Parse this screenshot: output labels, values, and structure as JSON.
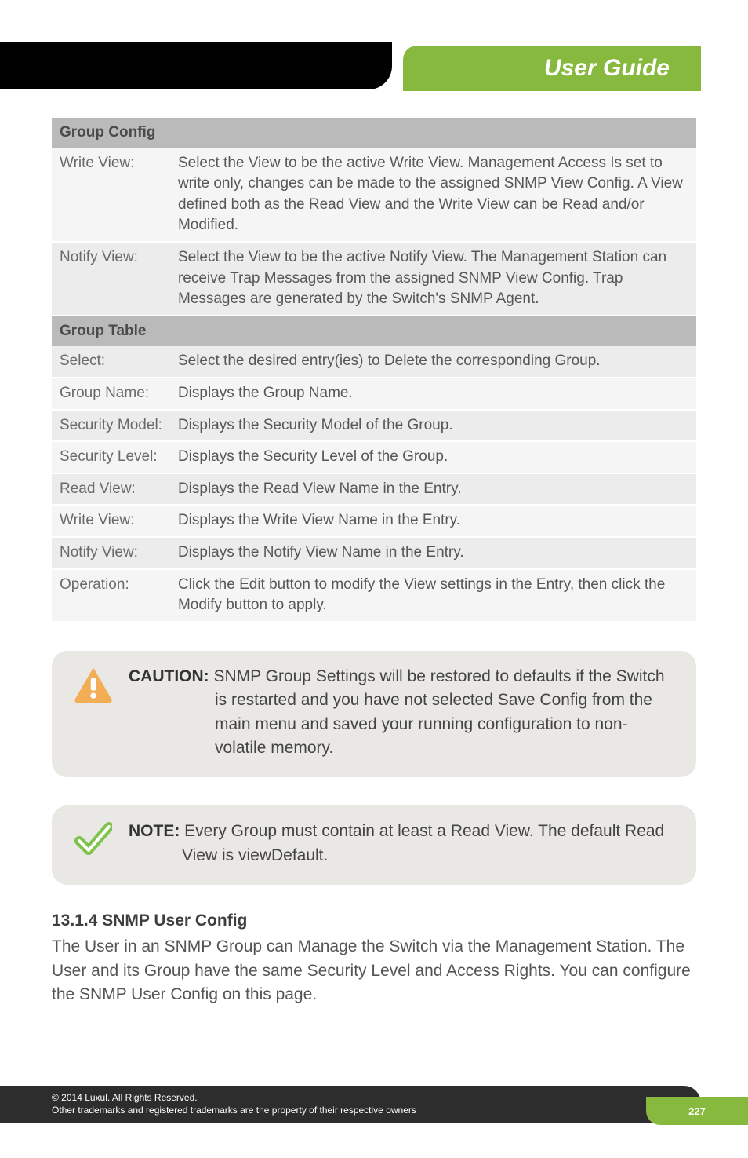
{
  "header": {
    "title": "User Guide"
  },
  "table": {
    "section1_title": "Group Config",
    "section1_rows": [
      {
        "label": "Write View:",
        "desc": "Select the View to be the active Write View. Management Access Is set to write only, changes can be made to the assigned SNMP View Config. A View defined both as the Read View and the Write View can be Read and/or Modified."
      },
      {
        "label": "Notify View:",
        "desc": "Select the View to be the active Notify View. The Management Station can receive Trap Messages from the assigned SNMP View Config. Trap Messages are generated by the Switch's SNMP Agent."
      }
    ],
    "section2_title": "Group Table",
    "section2_rows": [
      {
        "label": "Select:",
        "desc": "Select the desired entry(ies) to Delete the corresponding Group."
      },
      {
        "label": "Group Name:",
        "desc": "Displays the Group Name."
      },
      {
        "label": "Security Model:",
        "desc": "Displays the Security Model of the Group."
      },
      {
        "label": "Security Level:",
        "desc": "Displays the Security Level of the Group."
      },
      {
        "label": "Read View:",
        "desc": "Displays the Read View Name in the Entry."
      },
      {
        "label": "Write View:",
        "desc": "Displays the Write View Name in the Entry."
      },
      {
        "label": "Notify View:",
        "desc": "Displays the Notify View Name in the Entry."
      },
      {
        "label": "Operation:",
        "desc": "Click the Edit button to modify the View settings in the Entry, then click the Modify button to apply."
      }
    ]
  },
  "caution": {
    "label": "CAUTION:",
    "text": " SNMP Group Settings will be restored to defaults if the Switch is restarted and you have not selected Save Config from the main menu and saved your running configuration to non-volatile memory."
  },
  "note": {
    "label": "NOTE:",
    "text": " Every Group must contain at least a Read View. The default Read View is viewDefault."
  },
  "section": {
    "heading": "13.1.4 SNMP User Config",
    "body": "The User in an SNMP Group can Manage the Switch via the Management Station. The User and its Group have the same Security Level and Access Rights. You can configure the SNMP User Config on this page."
  },
  "footer": {
    "line1": "© 2014  Luxul. All Rights Reserved.",
    "line2": "Other trademarks and registered trademarks are the property of their respective owners",
    "page": "227"
  }
}
